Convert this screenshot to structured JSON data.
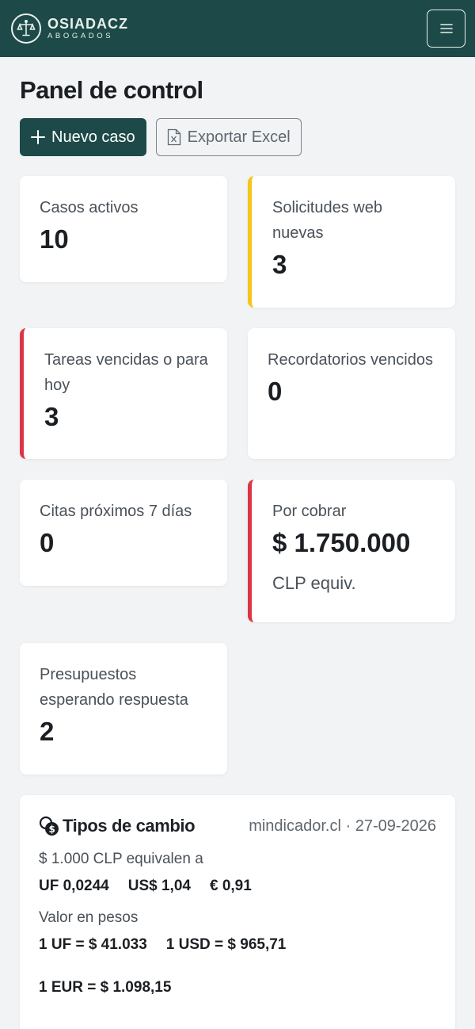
{
  "brand": {
    "name": "OSIADACZ",
    "sub": "ABOGADOS"
  },
  "page": {
    "title": "Panel de control"
  },
  "actions": {
    "new_case": "Nuevo caso",
    "export": "Exportar Excel"
  },
  "cards": [
    {
      "label": "Casos activos",
      "value": "10"
    },
    {
      "label": "Solicitudes web nuevas",
      "value": "3"
    },
    {
      "label": "Tareas vencidas o para hoy",
      "value": "3"
    },
    {
      "label": "Recordatorios vencidos",
      "value": "0"
    },
    {
      "label": "Citas próximos 7 días",
      "value": "0"
    },
    {
      "label": "Por cobrar",
      "value": "$ 1.750.000",
      "note": "CLP equiv."
    },
    {
      "label": "Presupuestos esperando respuesta",
      "value": "2"
    }
  ],
  "fx": {
    "title": "Tipos de cambio",
    "source": "mindicador.cl · 27-09-2026",
    "equiv_text": "$ 1.000 CLP equivalen a",
    "uf": "UF 0,0244",
    "usd": "US$ 1,04",
    "eur": "€ 0,91",
    "pesos_label": "Valor en pesos",
    "uf_pesos": "1 UF = $ 41.033",
    "usd_pesos": "1 USD = $ 965,71",
    "eur_pesos": "1 EUR = $ 1.098,15"
  },
  "colors": {
    "brand": "#1d4a48",
    "warning": "#f5c518",
    "danger": "#dc3545"
  },
  "icons": {
    "logo": "scales-icon",
    "menu": "hamburger-icon",
    "add": "plus-icon",
    "export": "excel-file-icon",
    "fx": "coins-icon"
  }
}
